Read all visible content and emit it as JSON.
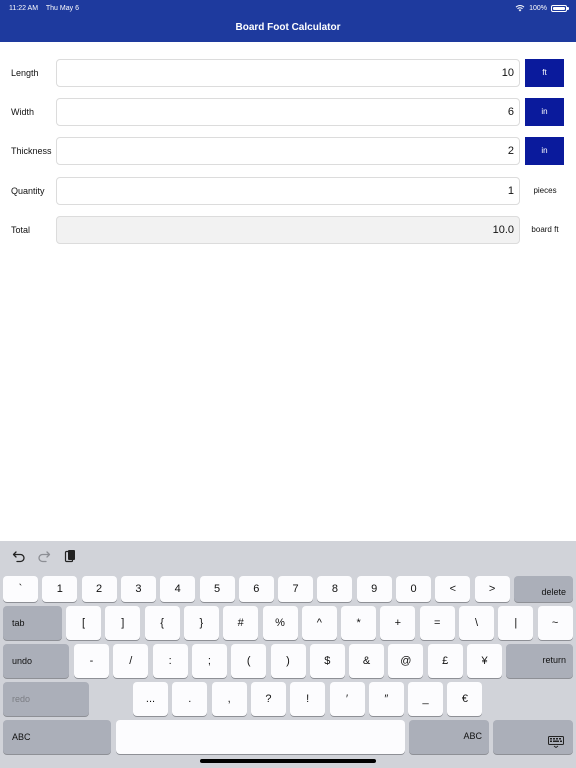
{
  "status": {
    "time": "11:22 AM",
    "date": "Thu May 6",
    "battery": "100%"
  },
  "header": {
    "title": "Board Foot Calculator"
  },
  "form": {
    "length": {
      "label": "Length",
      "value": "10",
      "unit": "ft"
    },
    "width": {
      "label": "Width",
      "value": "6",
      "unit": "in"
    },
    "thickness": {
      "label": "Thickness",
      "value": "2",
      "unit": "in"
    },
    "quantity": {
      "label": "Quantity",
      "value": "1",
      "unit": "pieces"
    },
    "total": {
      "label": "Total",
      "value": "10.0",
      "unit": "board ft"
    }
  },
  "keyboard": {
    "toolbar_icons": [
      "undo-icon",
      "redo-icon",
      "paste-icon"
    ],
    "row1": [
      "`",
      "1",
      "2",
      "3",
      "4",
      "5",
      "6",
      "7",
      "8",
      "9",
      "0",
      "<",
      ">"
    ],
    "delete_label": "delete",
    "tab_label": "tab",
    "row2": [
      "[",
      "]",
      "{",
      "}",
      "#",
      "%",
      "^",
      "*",
      "+",
      "=",
      "\\",
      "|",
      "~"
    ],
    "undo_label": "undo",
    "row3": [
      "-",
      "/",
      ":",
      ";",
      "(",
      ")",
      "$",
      "&",
      "@",
      "£",
      "¥"
    ],
    "return_label": "return",
    "redo_label": "redo",
    "row4": [
      "...",
      ".",
      ",",
      "?",
      "!",
      "′",
      "″",
      "_",
      "€"
    ],
    "abc_label": "ABC",
    "icons": {
      "dismiss": "keyboard-dismiss-icon"
    }
  }
}
